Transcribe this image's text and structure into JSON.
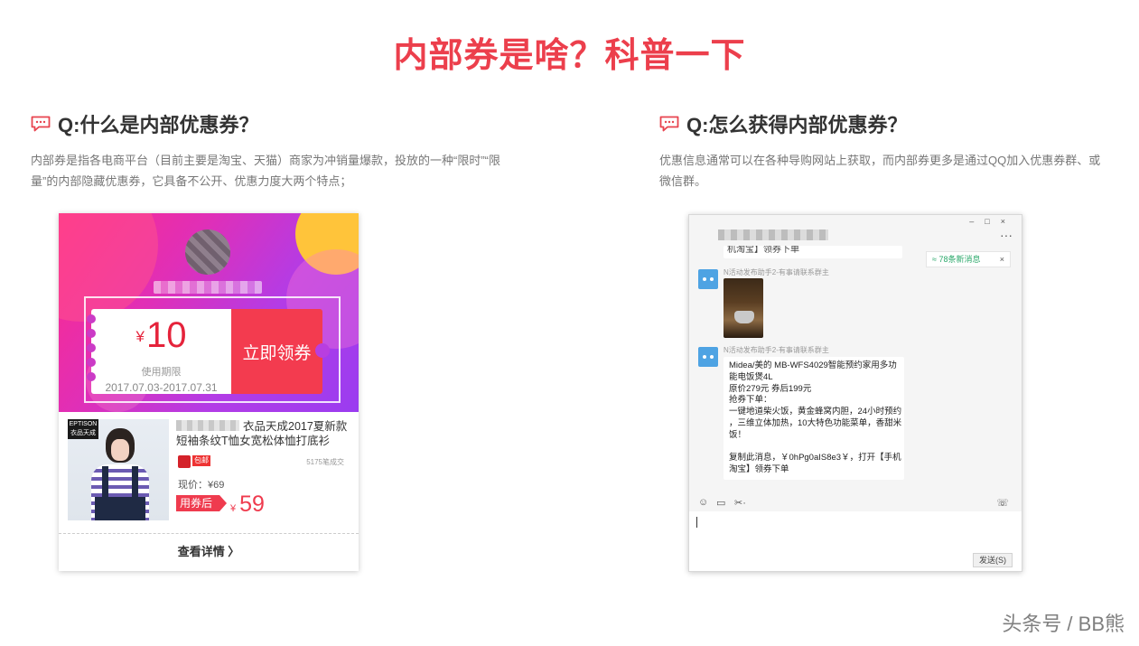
{
  "page_title": "内部券是啥？科普一下",
  "left": {
    "question": "Q:什么是内部优惠券？",
    "desc_line1": "内部券是指各电商平台（目前主要是淘宝、天猫）商家为冲销量爆款，投放的一种“限时”“限",
    "desc_line2": "量”的内部隐藏优惠券，它具备不公开、优惠力度大两个特点；",
    "coupon": {
      "currency": "¥",
      "amount": "10",
      "validity_label": "使用期限",
      "validity_dates": "2017.07.03-2017.07.31",
      "claim_label": "立即领券"
    },
    "product": {
      "brand_tag": "EPTISON 衣品天成",
      "name": "衣品天成2017夏新款短袖条纹T恤女宽松体恤打底衫",
      "tmall_tag": "包邮",
      "sold": "5175笔成交",
      "orig_price": "现价：¥69",
      "after_coupon_label": "用券后",
      "after_currency": "¥",
      "after_price": "59",
      "detail_link": "查看详情 〉"
    }
  },
  "right": {
    "question": "Q:怎么获得内部优惠券？",
    "desc_line1": "优惠信息通常可以在各种导购网站上获取，而内部券更多是通过QQ加入优惠券群、或",
    "desc_line2": "微信群。",
    "chat": {
      "window_controls": "–□×",
      "more": "···",
      "top_msg": "机淘宝】领券下单",
      "new_msg": "≈ 78条新消息",
      "new_msg_close": "×",
      "sender1": "N活动发布助手2-有事请联系群主",
      "sender2": "N活动发布助手2-有事请联系群主",
      "message_lines": [
        "Midea/美的 MB-WFS4029智能预约家用多功",
        "能电饭煲4L",
        "原价279元 券后199元",
        "抢券下单：",
        "一键地道柴火饭，黄金蜂窝内胆，24小时预约",
        "，三维立体加热，10大特色功能菜单，香甜米",
        "饭！",
        "",
        "复制此消息，￥0hPg0aIS8e3￥，打开【手机",
        "淘宝】领券下单"
      ],
      "toolbar_emoji": "☺",
      "toolbar_folder": "▭",
      "toolbar_scissors": "✂·",
      "toolbar_phone": "☏",
      "send_label": "发送(S)"
    }
  },
  "watermark": "头条号 / BB熊",
  "colors": {
    "title_red": "#ec3f4c",
    "coupon_red": "#f33b4f",
    "icon_red": "#e8444f"
  }
}
